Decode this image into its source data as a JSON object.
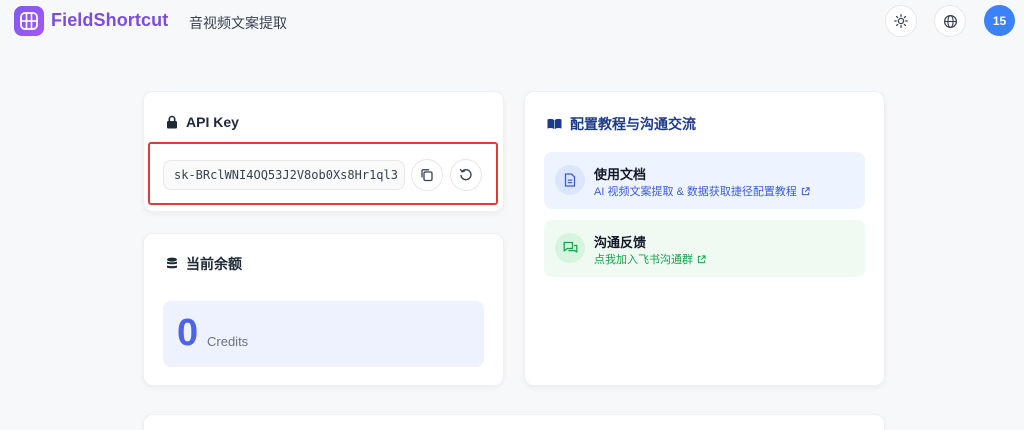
{
  "header": {
    "brand": "FieldShortcut",
    "subtitle": "音视频文案提取",
    "avatar_text": "15",
    "theme_icon": "sun-icon",
    "language_icon": "globe-icon"
  },
  "api_key_card": {
    "title": "API Key",
    "key_value": "sk-BRclWNI4OQ53J2V8ob0Xs8Hr1ql3",
    "copy_icon": "copy-icon",
    "refresh_icon": "refresh-icon"
  },
  "balance_card": {
    "title": "当前余额",
    "amount": "0",
    "unit": "Credits"
  },
  "guide_card": {
    "title": "配置教程与沟通交流",
    "docs": {
      "title": "使用文档",
      "link": "AI 视频文案提取 & 数据获取捷径配置教程"
    },
    "feedback": {
      "title": "沟通反馈",
      "link": "点我加入飞书沟通群"
    }
  },
  "colors": {
    "brand": "#7c4ddb",
    "accent_blue": "#4f63e6",
    "highlight_red": "#e53935",
    "feedback_green": "#16a34a"
  }
}
